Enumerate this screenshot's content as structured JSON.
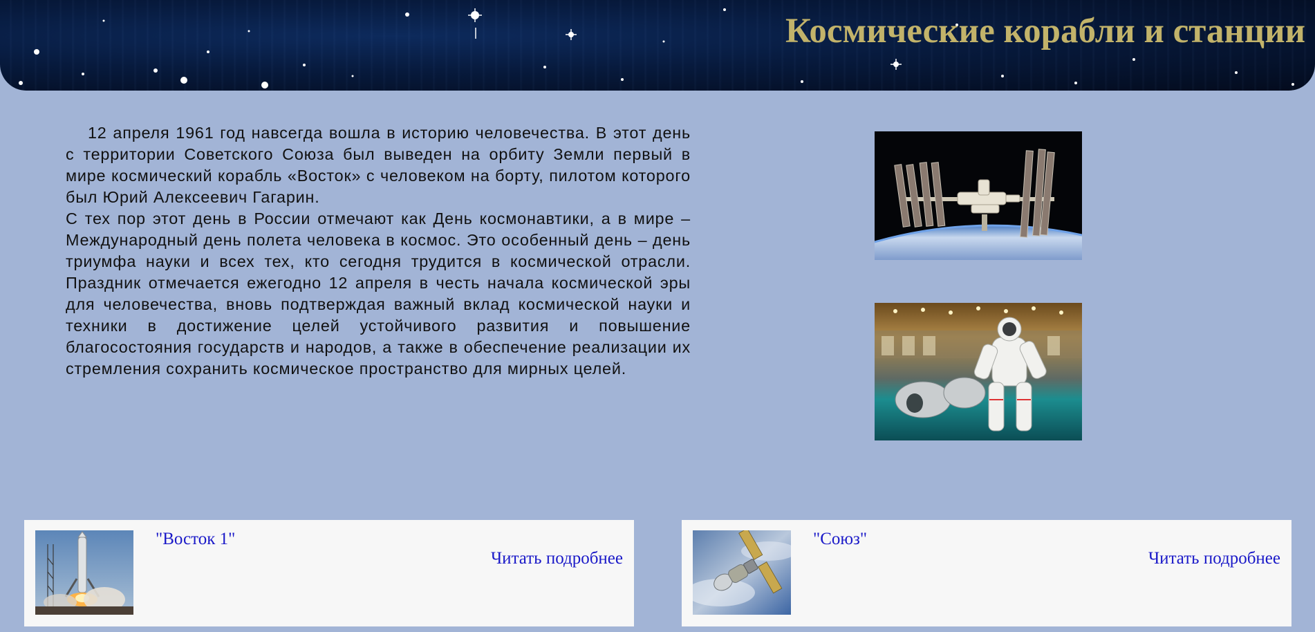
{
  "header": {
    "title": "Космические корабли и станции"
  },
  "intro": {
    "paragraph_1": "12 апреля 1961 год навсегда вошла в историю человечества. В этот день с территории Советского Союза был выведен на орбиту Земли первый в мире космический корабль «Восток» с человеком на борту, пилотом которого был Юрий Алексеевич Гагарин.",
    "paragraph_2": "С тех пор этот день в России отмечают как День космонавтики, а в мире – Международный день полета человека в космос. Это особенный день – день триумфа науки и всех тех, кто сегодня трудится в космической отрасли. Праздник отмечается ежегодно 12 апреля в честь начала космической эры для человечества, вновь подтверждая важный вклад космической науки и техники в достижение целей устойчивого развития и повышение благосостояния государств и народов, а также в обеспечение реализации их стремления сохранить космическое пространство для мирных целей."
  },
  "cards": [
    {
      "title": "\"Восток 1\"",
      "link": "Читать подробнее"
    },
    {
      "title": "\"Союз\"",
      "link": "Читать подробнее"
    }
  ],
  "colors": {
    "page_background": "#a2b4d6",
    "header_title": "#c2b36a",
    "link": "#1a19c8",
    "card_background": "#f7f7f7"
  }
}
